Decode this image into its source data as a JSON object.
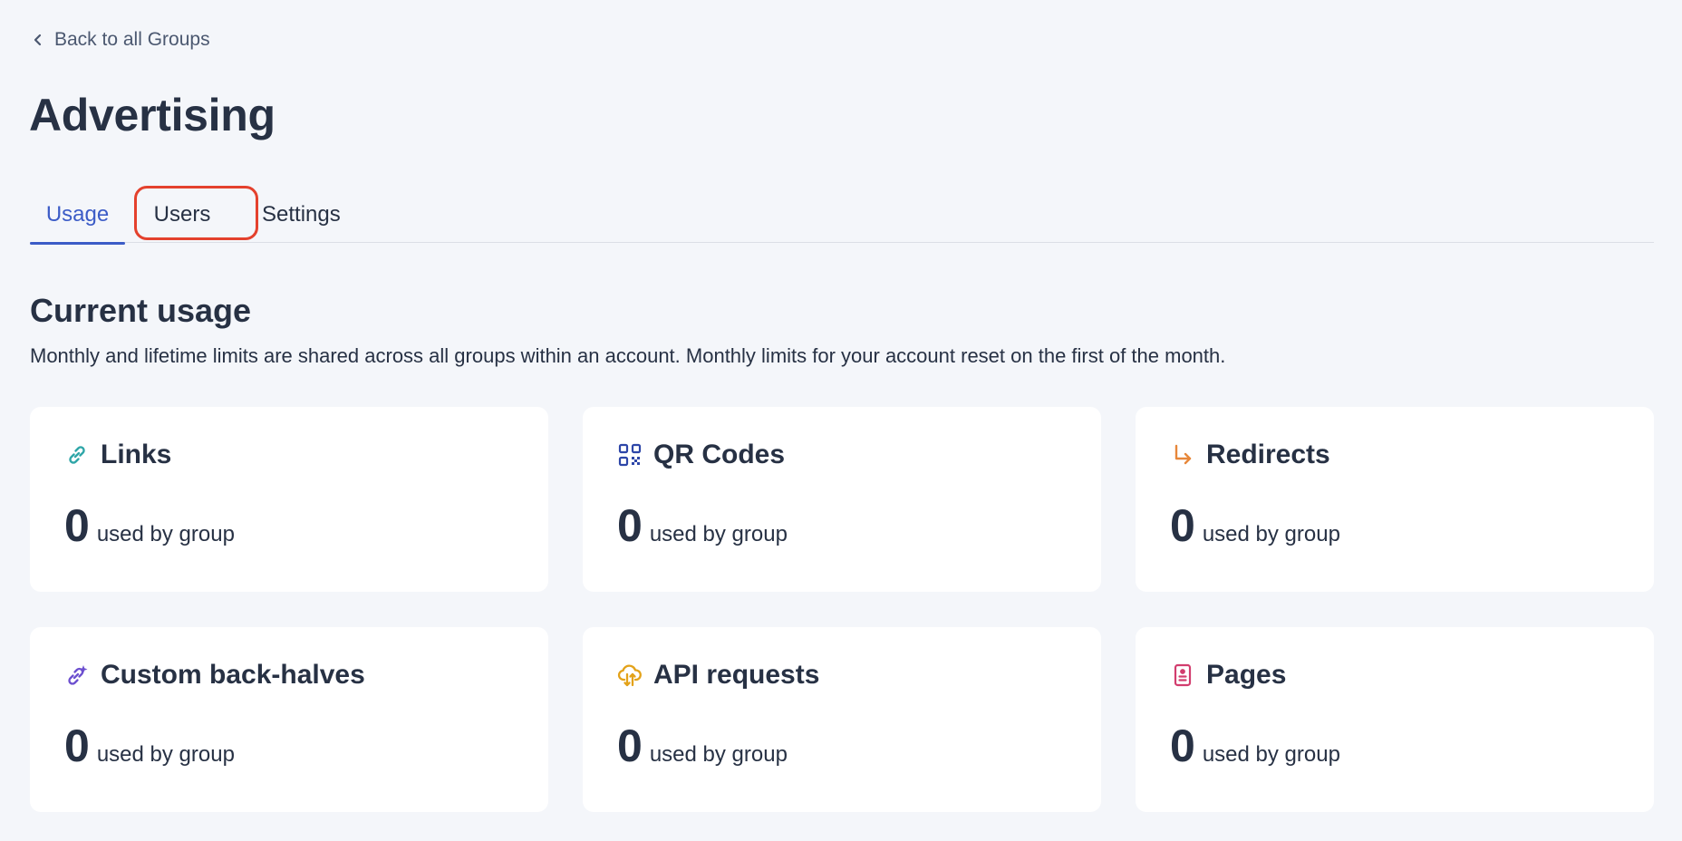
{
  "nav": {
    "back_label": "Back to all Groups"
  },
  "page": {
    "title": "Advertising"
  },
  "tabs": [
    {
      "label": "Usage",
      "active": true
    },
    {
      "label": "Users",
      "active": false
    },
    {
      "label": "Settings",
      "active": false
    }
  ],
  "usage": {
    "title": "Current usage",
    "description": "Monthly and lifetime limits are shared across all groups within an account. Monthly limits for your account reset on the first of the month.",
    "cards": [
      {
        "title": "Links",
        "value": "0",
        "label": "used by group",
        "icon": "link-icon",
        "color": "#2fa6a8"
      },
      {
        "title": "QR Codes",
        "value": "0",
        "label": "used by group",
        "icon": "qr-code-icon",
        "color": "#2d46a8"
      },
      {
        "title": "Redirects",
        "value": "0",
        "label": "used by group",
        "icon": "redirect-arrow-icon",
        "color": "#e7873a"
      },
      {
        "title": "Custom back-halves",
        "value": "0",
        "label": "used by group",
        "icon": "sparkle-link-icon",
        "color": "#6c4fcf"
      },
      {
        "title": "API requests",
        "value": "0",
        "label": "used by group",
        "icon": "cloud-transfer-icon",
        "color": "#e3a21a"
      },
      {
        "title": "Pages",
        "value": "0",
        "label": "used by group",
        "icon": "page-icon",
        "color": "#d23d6e"
      }
    ]
  },
  "colors": {
    "accent": "#3c5cc7",
    "highlight": "#e4412d",
    "background": "#f4f6fa",
    "text": "#273144"
  }
}
